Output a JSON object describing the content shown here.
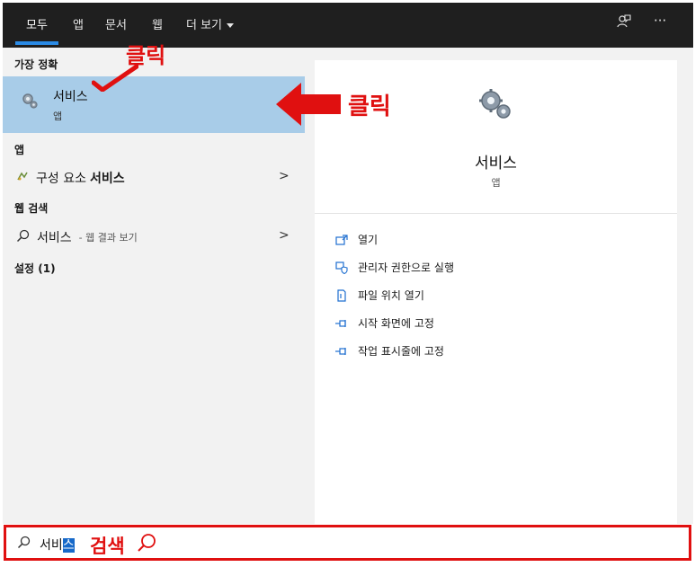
{
  "tabs": [
    {
      "label": "모두",
      "active": true
    },
    {
      "label": "앱"
    },
    {
      "label": "문서"
    },
    {
      "label": "웹"
    },
    {
      "label": "더 보기"
    }
  ],
  "topbar_icons": [
    "feedback-icon",
    "more-icon"
  ],
  "left": {
    "best_match_label": "가장 정확",
    "best_match": {
      "title": "서비스",
      "subtitle": "앱",
      "icon": "gears-icon"
    },
    "apps_label": "앱",
    "apps": [
      {
        "prefix": "구성 요소",
        "bold": "서비스"
      }
    ],
    "web_label": "웹 검색",
    "web": [
      {
        "title": "서비스",
        "suffix": "- 웹 결과 보기"
      }
    ],
    "settings_label": "설정 (1)"
  },
  "detail": {
    "title": "서비스",
    "subtitle": "앱",
    "actions": [
      {
        "label": "열기",
        "icon": "open-icon"
      },
      {
        "label": "관리자 권한으로 실행",
        "icon": "shield-icon"
      },
      {
        "label": "파일 위치 열기",
        "icon": "file-location-icon"
      },
      {
        "label": "시작 화면에 고정",
        "icon": "pin-icon"
      },
      {
        "label": "작업 표시줄에 고정",
        "icon": "pin-icon"
      }
    ]
  },
  "search": {
    "typed": "서비",
    "selected": "스"
  },
  "annotations": {
    "click_top": "클릭",
    "click_arrow": "클릭",
    "search_label": "검색",
    "color": "#e01010"
  }
}
